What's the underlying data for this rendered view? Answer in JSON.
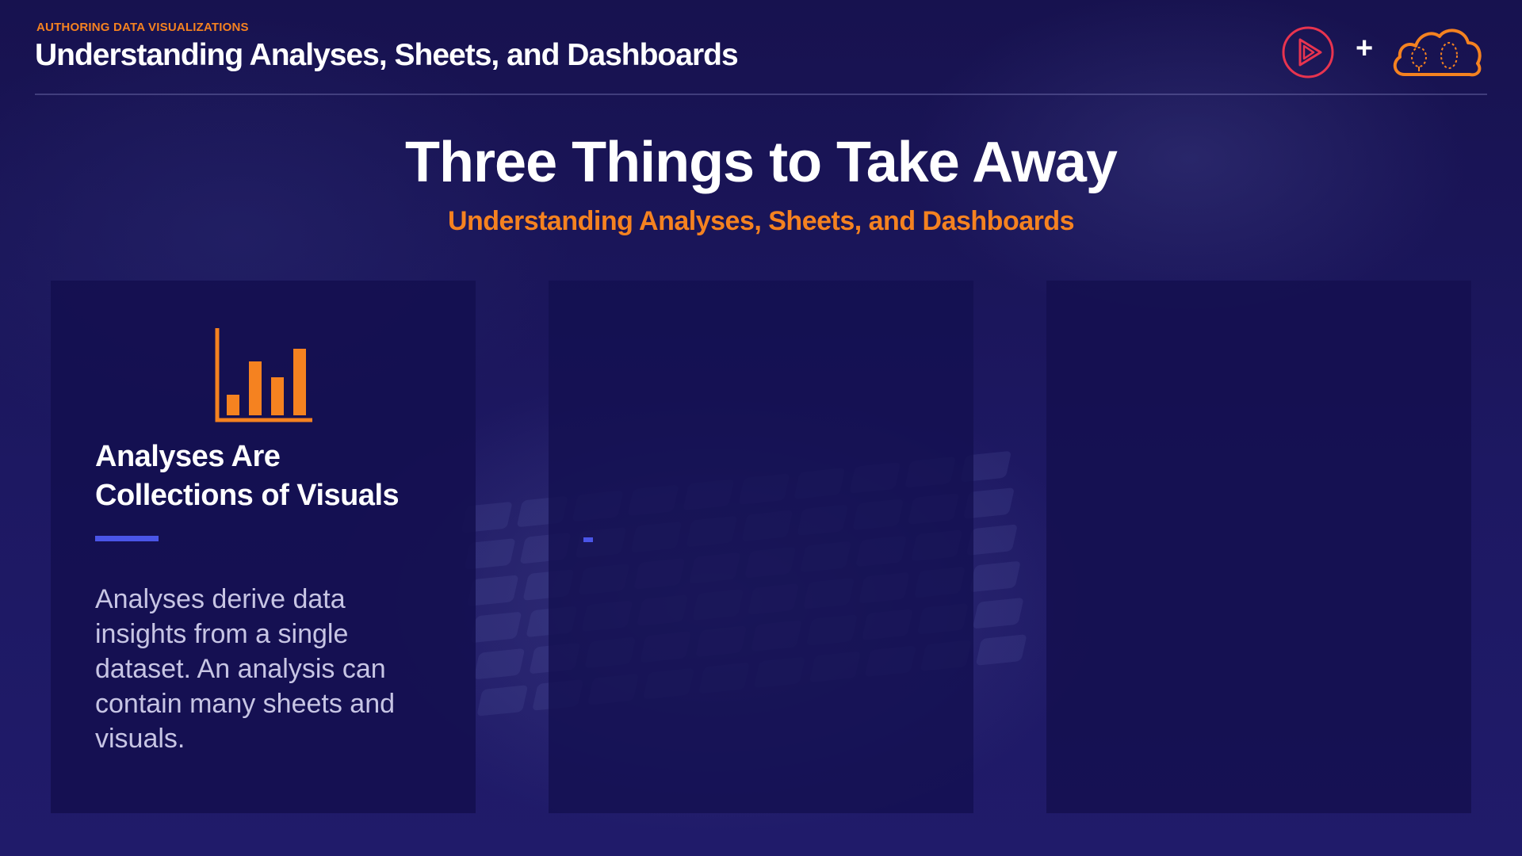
{
  "header": {
    "eyebrow": "AUTHORING DATA VISUALIZATIONS",
    "title": "Understanding Analyses, Sheets, and Dashboards",
    "plus": "+"
  },
  "slide": {
    "title": "Three Things to Take Away",
    "subtitle": "Understanding Analyses, Sheets, and Dashboards"
  },
  "cards": [
    {
      "icon": "bar-chart-icon",
      "heading": "Analyses Are Collections of Visuals",
      "body": "Analyses derive data insights from a single dataset. An analysis can contain many sheets and visuals."
    },
    {
      "icon": "",
      "heading": "",
      "body": ""
    },
    {
      "icon": "",
      "heading": "",
      "body": ""
    }
  ],
  "colors": {
    "background": "#1a155b",
    "accent_orange": "#f58220",
    "accent_blue": "#4a55e8",
    "play_logo": "#e8344f"
  }
}
